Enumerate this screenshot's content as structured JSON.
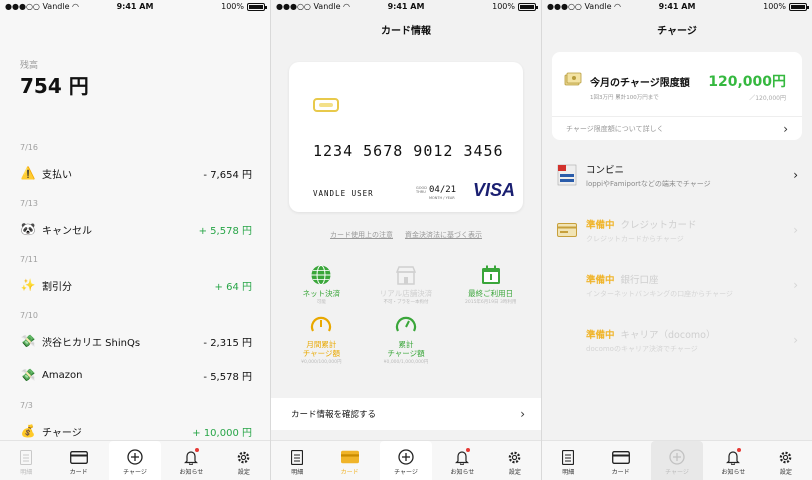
{
  "status": {
    "carrier": "●●●○○ Vandle",
    "time": "9:41 AM",
    "battery": "100%"
  },
  "screen1": {
    "balance_label": "残高",
    "balance_value": "754 円",
    "groups": [
      {
        "date": "7/16",
        "items": [
          {
            "icon": "warning-icon",
            "glyph": "⚠️",
            "name": "支払い",
            "amount": "- 7,654 円",
            "positive": false
          }
        ]
      },
      {
        "date": "7/13",
        "items": [
          {
            "icon": "cancel-icon",
            "glyph": "🐼",
            "name": "キャンセル",
            "amount": "+ 5,578 円",
            "positive": true
          }
        ]
      },
      {
        "date": "7/11",
        "items": [
          {
            "icon": "sparkle-icon",
            "glyph": "✨",
            "name": "割引分",
            "amount": "+ 64 円",
            "positive": true
          }
        ]
      },
      {
        "date": "7/10",
        "items": [
          {
            "icon": "money-icon",
            "glyph": "💸",
            "name": "渋谷ヒカリエ ShinQs",
            "amount": "- 2,315 円",
            "positive": false
          },
          {
            "icon": "money-icon",
            "glyph": "💸",
            "name": "Amazon",
            "amount": "- 5,578 円",
            "positive": false
          }
        ]
      },
      {
        "date": "7/3",
        "items": [
          {
            "icon": "moneybag-icon",
            "glyph": "💰",
            "name": "チャージ",
            "amount": "+ 10,000 円",
            "positive": true
          }
        ]
      }
    ]
  },
  "tabs": {
    "statement": "明細",
    "card": "カード",
    "charge": "チャージ",
    "notice": "お知らせ",
    "settings": "設定"
  },
  "screen2": {
    "title": "カード情報",
    "card": {
      "number": "1234 5678 9012 3456",
      "holder": "VANDLE USER",
      "expiry": "04/21",
      "expiry_label": "GOOD\nTHRU",
      "expiry_sub": "MONTH / YEAR",
      "brand": "VISA"
    },
    "links": [
      "カード使用上の注意",
      "資金決済法に基づく表示"
    ],
    "features": [
      {
        "icon": "globe-icon",
        "label": "ネット決済",
        "sub": "可能",
        "style": "grn",
        "dim": false
      },
      {
        "icon": "store-icon",
        "label": "リアル店舗決済",
        "sub": "不可・ブラを一本拘付",
        "style": "",
        "dim": true
      },
      {
        "icon": "calendar-icon",
        "label": "最終ご利用日",
        "sub": "2015年6月19日 3時利用",
        "style": "grn",
        "dim": false
      },
      {
        "icon": "gauge-icon",
        "label": "月間累計\nチャージ額",
        "sub": "¥0,000/100,000円",
        "style": "yel",
        "dim": false
      },
      {
        "icon": "gauge-icon",
        "label": "累計\nチャージ額",
        "sub": "¥0,000/1,000,000円",
        "style": "grn",
        "dim": false
      }
    ],
    "confirm_label": "カード情報を確認する"
  },
  "screen3": {
    "title": "チャージ",
    "limit": {
      "title": "今月のチャージ限度額",
      "value": "120,000円",
      "sub": "1回3万円 累計100万円まで",
      "sub2": "／120,000円",
      "link": "チャージ限度額について詳しく"
    },
    "options": [
      {
        "icon": "convenience-store-icon",
        "pending": "",
        "title": "コンビニ",
        "sub": "loppiやFamiportなどの端末でチャージ",
        "dim": false
      },
      {
        "icon": "credit-card-icon",
        "pending": "準備中",
        "title": "クレジットカード",
        "sub": "クレジットカードからチャージ",
        "dim": true
      },
      {
        "icon": "bank-icon",
        "pending": "準備中",
        "title": "銀行口座",
        "sub": "インターネットバンキングの口座からチャージ",
        "dim": true
      },
      {
        "icon": "carrier-icon",
        "pending": "準備中",
        "title": "キャリア（docomo）",
        "sub": "docomoのキャリア決済でチャージ",
        "dim": true
      }
    ]
  },
  "colors": {
    "green": "#27a547",
    "yellow": "#f0b429",
    "visa": "#1a1f71"
  }
}
